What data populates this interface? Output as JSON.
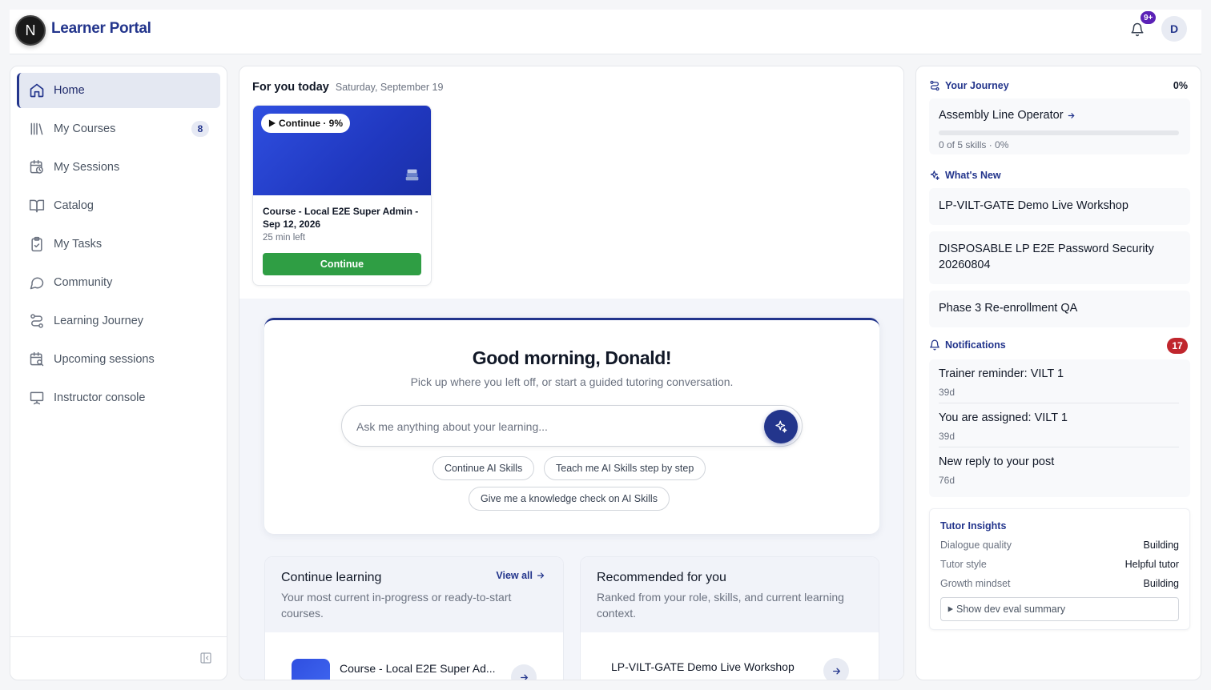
{
  "header": {
    "logo_letter": "N",
    "brand": "Learner Portal",
    "notif_badge": "9+",
    "avatar_letter": "D"
  },
  "sidebar": {
    "items": [
      {
        "label": "Home",
        "icon": "home-icon",
        "active": true
      },
      {
        "label": "My Courses",
        "icon": "library-icon",
        "count": "8"
      },
      {
        "label": "My Sessions",
        "icon": "calendar-clock-icon"
      },
      {
        "label": "Catalog",
        "icon": "book-open-icon"
      },
      {
        "label": "My Tasks",
        "icon": "clipboard-check-icon"
      },
      {
        "label": "Community",
        "icon": "chat-bubble-icon"
      },
      {
        "label": "Learning Journey",
        "icon": "route-icon"
      },
      {
        "label": "Upcoming sessions",
        "icon": "calendar-search-icon"
      },
      {
        "label": "Instructor console",
        "icon": "presentation-icon"
      }
    ]
  },
  "today": {
    "title": "For you today",
    "date": "Saturday, September 19",
    "card": {
      "pill": "Continue · 9%",
      "title": "Course - Local E2E Super Admin - Sep 12, 2026",
      "time_left": "25 min left",
      "button": "Continue"
    }
  },
  "chat": {
    "greeting": "Good morning, Donald!",
    "subtitle": "Pick up where you left off, or start a guided tutoring conversation.",
    "placeholder": "Ask me anything about your learning...",
    "chips": [
      "Continue AI Skills",
      "Teach me AI Skills step by step",
      "Give me a knowledge check on AI Skills"
    ]
  },
  "continue_learning": {
    "title": "Continue learning",
    "subtitle": "Your most current in-progress or ready-to-start courses.",
    "view_all": "View all",
    "first_item": "Course - Local E2E Super Ad..."
  },
  "recommended": {
    "title": "Recommended for you",
    "subtitle": "Ranked from your role, skills, and current learning context.",
    "first_item": "LP-VILT-GATE Demo Live Workshop"
  },
  "journey": {
    "heading": "Your Journey",
    "percent": "0%",
    "progress": 0,
    "title": "Assembly Line Operator",
    "meta": "0 of 5 skills · 0%"
  },
  "whats_new": {
    "heading": "What's New",
    "items": [
      "LP-VILT-GATE Demo Live Workshop",
      "DISPOSABLE LP E2E Password Security 20260804",
      "Phase 3 Re-enrollment QA"
    ]
  },
  "notifications": {
    "heading": "Notifications",
    "count": "17",
    "items": [
      {
        "title": "Trainer reminder: VILT 1",
        "time": "39d"
      },
      {
        "title": "You are assigned: VILT 1",
        "time": "39d"
      },
      {
        "title": "New reply to your post",
        "time": "76d"
      }
    ]
  },
  "insights": {
    "heading": "Tutor Insights",
    "rows": [
      {
        "key": "Dialogue quality",
        "value": "Building"
      },
      {
        "key": "Tutor style",
        "value": "Helpful tutor"
      },
      {
        "key": "Growth mindset",
        "value": "Building"
      }
    ],
    "dev_button": "Show dev eval summary"
  },
  "colors": {
    "brand": "#23358c",
    "continue_green": "#2f9e44",
    "notif_red": "#c0262d",
    "badge_purple": "#5b21b6"
  }
}
